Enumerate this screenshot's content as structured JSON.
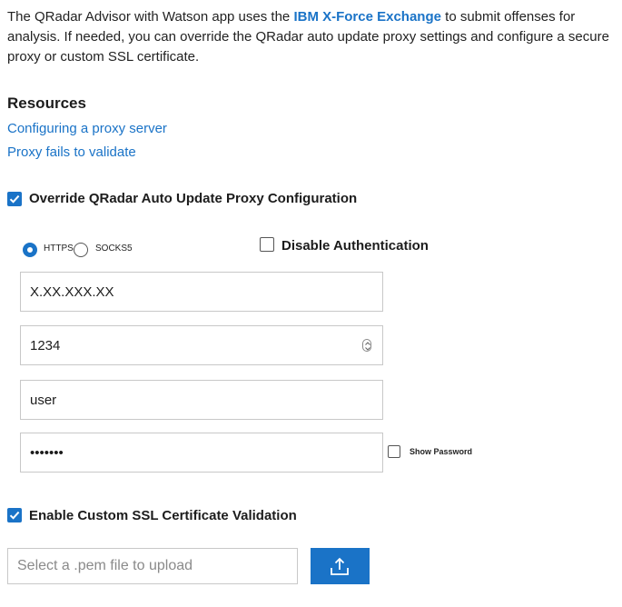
{
  "intro": {
    "prefix": "The QRadar Advisor with Watson app uses the ",
    "link": "IBM X-Force Exchange",
    "suffix": " to submit offenses for analysis. If needed, you can override the QRadar auto update proxy settings and configure a secure proxy or custom SSL certificate."
  },
  "resources": {
    "title": "Resources",
    "links": [
      "Configuring a proxy server",
      "Proxy fails to validate"
    ]
  },
  "override": {
    "label": "Override QRadar Auto Update Proxy Configuration",
    "checked": true
  },
  "protocol": {
    "options": [
      "HTTPS",
      "SOCKS5"
    ],
    "selected": "HTTPS"
  },
  "disable_auth": {
    "label": "Disable Authentication",
    "checked": false
  },
  "fields": {
    "host": "X.XX.XXX.XX",
    "port": "1234",
    "username": "user",
    "password": "•••••••"
  },
  "show_password": {
    "label": "Show Password",
    "checked": false
  },
  "ssl": {
    "label": "Enable Custom SSL Certificate Validation",
    "checked": true
  },
  "upload": {
    "placeholder": "Select a .pem file to upload",
    "button_icon": "upload-icon"
  },
  "colors": {
    "accent": "#1a73c7",
    "border": "#c8c8c8"
  }
}
